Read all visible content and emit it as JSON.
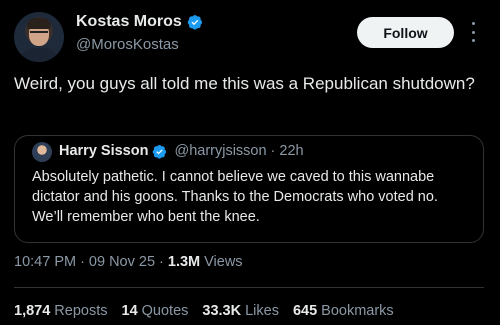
{
  "author": {
    "name": "Kostas Moros",
    "handle": "@MorosKostas"
  },
  "follow_label": "Follow",
  "tweet_text": "Weird, you guys all told me this was a Republican shutdown?",
  "quote": {
    "name": "Harry Sisson",
    "handle": "@harryjsisson",
    "age": "· 22h",
    "text": "Absolutely pathetic. I cannot believe we caved to this wannabe dictator and his goons. Thanks to the Democrats who voted no. We’ll remember who bent the knee."
  },
  "meta": {
    "time": "10:47 PM",
    "sep1": "·",
    "date": "09 Nov 25",
    "sep2": "·",
    "views_count": "1.3M",
    "views_label": "Views"
  },
  "stats": {
    "reposts_count": "1,874",
    "reposts_label": "Reposts",
    "quotes_count": "14",
    "quotes_label": "Quotes",
    "likes_count": "33.3K",
    "likes_label": "Likes",
    "bookmarks_count": "645",
    "bookmarks_label": "Bookmarks"
  },
  "colors": {
    "background": "#000000",
    "text": "#e7e9ea",
    "secondary_text": "#8b98a5",
    "verified_badge": "#1d9bf0",
    "follow_button_bg": "#eff3f4"
  },
  "icons": {
    "verified": "verified-badge-icon",
    "more": "more-vertical-icon"
  }
}
